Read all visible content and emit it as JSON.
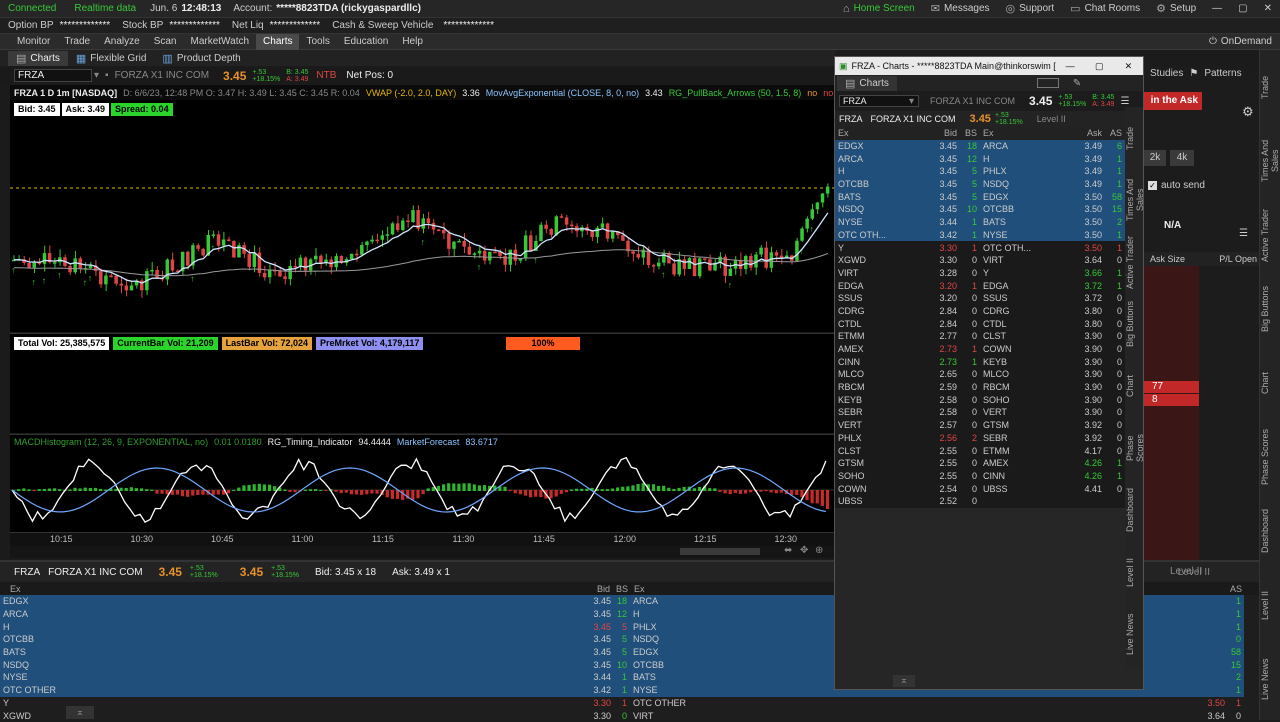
{
  "top": {
    "connected": "Connected",
    "realtime": "Realtime data",
    "date_label": "Jun. 6",
    "time": "12:48:13",
    "account_label": "Account:",
    "account": "*****8823TDA (rickygaspardllc)",
    "home": "Home Screen",
    "messages": "Messages",
    "support": "Support",
    "chatrooms": "Chat Rooms",
    "setup": "Setup"
  },
  "balances": [
    {
      "label": "Option BP",
      "value": "*************"
    },
    {
      "label": "Stock BP",
      "value": "*************"
    },
    {
      "label": "Net Liq",
      "value": "*************"
    },
    {
      "label": "Cash & Sweep Vehicle",
      "value": "*************"
    }
  ],
  "menu": {
    "items": [
      "Monitor",
      "Trade",
      "Analyze",
      "Scan",
      "MarketWatch",
      "Charts",
      "Tools",
      "Education",
      "Help"
    ],
    "active": "Charts",
    "ondemand": "OnDemand"
  },
  "charts_toolbar": {
    "charts": "Charts",
    "flexible_grid": "Flexible Grid",
    "product_depth": "Product Depth",
    "studies": "Studies",
    "patterns": "Patterns"
  },
  "symbol": {
    "ticker": "FRZA",
    "name": "FORZA X1 INC COM",
    "last": "3.45",
    "change": "+.53",
    "pct": "+18.15%",
    "bid": "B: 3.45",
    "ask": "A: 3.49",
    "ntb": "NTB",
    "netpos": "Net Pos: 0"
  },
  "studybar": {
    "header": "FRZA 1 D 1m [NASDAQ]",
    "ohlc": "D: 6/6/23, 12:48 PM   O: 3.47   H: 3.49   L: 3.45   C: 3.45   R: 0.04",
    "vwap": "VWAP (-2.0, 2.0, DAY)",
    "vwap_val": "3.36",
    "mav": "MovAvgExponential (CLOSE, 8, 0, no)",
    "mav_val": "3.43",
    "rg": "RG_PullBack_Arrows (50, 1.5, 8)",
    "no1": "no",
    "no2": "no"
  },
  "quote_badges": {
    "bid": "Bid: 3.45",
    "ask": "Ask: 3.49",
    "spread": "Spread: 0.04"
  },
  "volume_badges": {
    "total": "Total Vol: 25,385,575",
    "current": "CurrentBar Vol: 21,209",
    "last": "LastBar Vol: 72,024",
    "pre": "PreMrket Vol: 4,179,117",
    "sellers": "100% SELLERS"
  },
  "macd_header": {
    "macd": "MACDHistogram (12, 26, 9, EXPONENTIAL, no)",
    "macd_val": "0.01 0.0180",
    "rg": "RG_Timing_Indicator",
    "rg_val": "94.4444",
    "mf": "MarketForecast",
    "mf_val": "83.6717"
  },
  "time_axis": [
    "10:15",
    "10:30",
    "10:45",
    "11:00",
    "11:15",
    "11:30",
    "11:45",
    "12:00",
    "12:15",
    "12:30"
  ],
  "popup": {
    "title": "FRZA - Charts - *****8823TDA Main@thinkorswim [bui...",
    "tab": "Charts",
    "buy_ask": "in the Ask",
    "level2": "Level II",
    "bid_cols": [
      "Ex",
      "Bid",
      "BS"
    ],
    "ask_cols": [
      "Ex",
      "Ask",
      "AS"
    ],
    "bids": [
      [
        "EDGX",
        "3.45",
        "18",
        "b"
      ],
      [
        "ARCA",
        "3.45",
        "12",
        "b"
      ],
      [
        "H",
        "3.45",
        "5",
        "b"
      ],
      [
        "OTCBB",
        "3.45",
        "5",
        "b"
      ],
      [
        "BATS",
        "3.45",
        "5",
        "b"
      ],
      [
        "NSDQ",
        "3.45",
        "10",
        "b"
      ],
      [
        "NYSE",
        "3.44",
        "1",
        "b"
      ],
      [
        "OTC OTH...",
        "3.42",
        "1",
        "b"
      ],
      [
        "Y",
        "3.30",
        "1",
        "r"
      ],
      [
        "XGWD",
        "3.30",
        "0",
        ""
      ],
      [
        "VIRT",
        "3.28",
        "0",
        ""
      ],
      [
        "EDGA",
        "3.20",
        "1",
        "r"
      ],
      [
        "SSUS",
        "3.20",
        "0",
        ""
      ],
      [
        "CDRG",
        "2.84",
        "0",
        ""
      ],
      [
        "CTDL",
        "2.84",
        "0",
        ""
      ],
      [
        "ETMM",
        "2.77",
        "0",
        ""
      ],
      [
        "AMEX",
        "2.73",
        "1",
        "r"
      ],
      [
        "CINN",
        "2.73",
        "1",
        "g"
      ],
      [
        "MLCO",
        "2.65",
        "0",
        ""
      ],
      [
        "RBCM",
        "2.59",
        "0",
        ""
      ],
      [
        "KEYB",
        "2.58",
        "0",
        ""
      ],
      [
        "SEBR",
        "2.58",
        "0",
        ""
      ],
      [
        "VERT",
        "2.57",
        "0",
        ""
      ],
      [
        "PHLX",
        "2.56",
        "2",
        "r"
      ],
      [
        "CLST",
        "2.55",
        "0",
        ""
      ],
      [
        "GTSM",
        "2.55",
        "0",
        ""
      ],
      [
        "SOHO",
        "2.55",
        "0",
        ""
      ],
      [
        "COWN",
        "2.54",
        "0",
        ""
      ],
      [
        "UBSS",
        "2.52",
        "0",
        ""
      ]
    ],
    "asks": [
      [
        "ARCA",
        "3.49",
        "6",
        "b"
      ],
      [
        "H",
        "3.49",
        "1",
        "b"
      ],
      [
        "PHLX",
        "3.49",
        "1",
        "b"
      ],
      [
        "NSDQ",
        "3.49",
        "1",
        "b"
      ],
      [
        "EDGX",
        "3.50",
        "58",
        "b"
      ],
      [
        "OTCBB",
        "3.50",
        "15",
        "b"
      ],
      [
        "BATS",
        "3.50",
        "2",
        "b"
      ],
      [
        "NYSE",
        "3.50",
        "1",
        "b"
      ],
      [
        "OTC OTH...",
        "3.50",
        "1",
        "r"
      ],
      [
        "VIRT",
        "3.64",
        "0",
        ""
      ],
      [
        "Y",
        "3.66",
        "1",
        "g"
      ],
      [
        "EDGA",
        "3.72",
        "1",
        "g"
      ],
      [
        "SSUS",
        "3.72",
        "0",
        ""
      ],
      [
        "CDRG",
        "3.80",
        "0",
        ""
      ],
      [
        "CTDL",
        "3.80",
        "0",
        ""
      ],
      [
        "CLST",
        "3.90",
        "0",
        ""
      ],
      [
        "COWN",
        "3.90",
        "0",
        ""
      ],
      [
        "KEYB",
        "3.90",
        "0",
        ""
      ],
      [
        "MLCO",
        "3.90",
        "0",
        ""
      ],
      [
        "RBCM",
        "3.90",
        "0",
        ""
      ],
      [
        "SOHO",
        "3.90",
        "0",
        ""
      ],
      [
        "VERT",
        "3.90",
        "0",
        ""
      ],
      [
        "GTSM",
        "3.92",
        "0",
        ""
      ],
      [
        "SEBR",
        "3.92",
        "0",
        ""
      ],
      [
        "ETMM",
        "4.17",
        "0",
        ""
      ],
      [
        "AMEX",
        "4.26",
        "1",
        "g"
      ],
      [
        "CINN",
        "4.26",
        "1",
        "g"
      ],
      [
        "UBSS",
        "4.41",
        "0",
        ""
      ]
    ]
  },
  "right_panel": {
    "btn2k": "2k",
    "btn4k": "4k",
    "auto_send": "auto send",
    "na": "N/A",
    "ask_size": "Ask Size",
    "pl_open": "P/L Open",
    "v1": "77",
    "v2": "8",
    "level2": "Level II"
  },
  "side_tabs": [
    "Trade",
    "Times And Sales",
    "Active Trader",
    "Big Buttons",
    "Chart",
    "Phase Scores",
    "Dashboard",
    "Level II",
    "Live News"
  ],
  "popup_tabs": [
    "Trade",
    "Times And Sales",
    "Active Trader",
    "Big Buttons",
    "Chart",
    "Phase Scores",
    "Dashboard",
    "Level II",
    "Live News"
  ],
  "bottom": {
    "ticker": "FRZA",
    "name": "FORZA X1 INC COM",
    "last1": "3.45",
    "last2": "3.45",
    "change": "+.53",
    "pct": "+18.15%",
    "bid": "Bid: 3.45 x 18",
    "ask": "Ask: 3.49 x 1",
    "level2": "Level II",
    "bids": [
      [
        "EDGX",
        "3.45",
        "18",
        "b"
      ],
      [
        "ARCA",
        "3.45",
        "12",
        "b"
      ],
      [
        "H",
        "3.45",
        "5",
        "r"
      ],
      [
        "OTCBB",
        "3.45",
        "5",
        "b"
      ],
      [
        "BATS",
        "3.45",
        "5",
        "b"
      ],
      [
        "NSDQ",
        "3.45",
        "10",
        "b"
      ],
      [
        "NYSE",
        "3.44",
        "1",
        "b"
      ],
      [
        "OTC OTHER",
        "3.42",
        "1",
        "b"
      ],
      [
        "Y",
        "3.30",
        "1",
        "r"
      ],
      [
        "XGWD",
        "3.30",
        "0",
        "b"
      ]
    ],
    "asks": [
      [
        "ARCA",
        "",
        "1",
        "b"
      ],
      [
        "H",
        "",
        "1",
        "b"
      ],
      [
        "PHLX",
        "",
        "1",
        "b"
      ],
      [
        "NSDQ",
        "",
        "0",
        "b"
      ],
      [
        "EDGX",
        "",
        "58",
        "b"
      ],
      [
        "OTCBB",
        "",
        "15",
        "b"
      ],
      [
        "BATS",
        "",
        "2",
        "b"
      ],
      [
        "NYSE",
        "",
        "1",
        "b"
      ],
      [
        "OTC OTHER",
        "3.50",
        "1",
        "r"
      ],
      [
        "VIRT",
        "3.64",
        "0",
        ""
      ]
    ]
  },
  "colors": {
    "bull": "#37c837",
    "bear": "#e04545",
    "ema": "#cfe4ff",
    "vwap": "#9a9a9a",
    "blue": "#1f4f7a",
    "dashed": "#e6b800"
  }
}
